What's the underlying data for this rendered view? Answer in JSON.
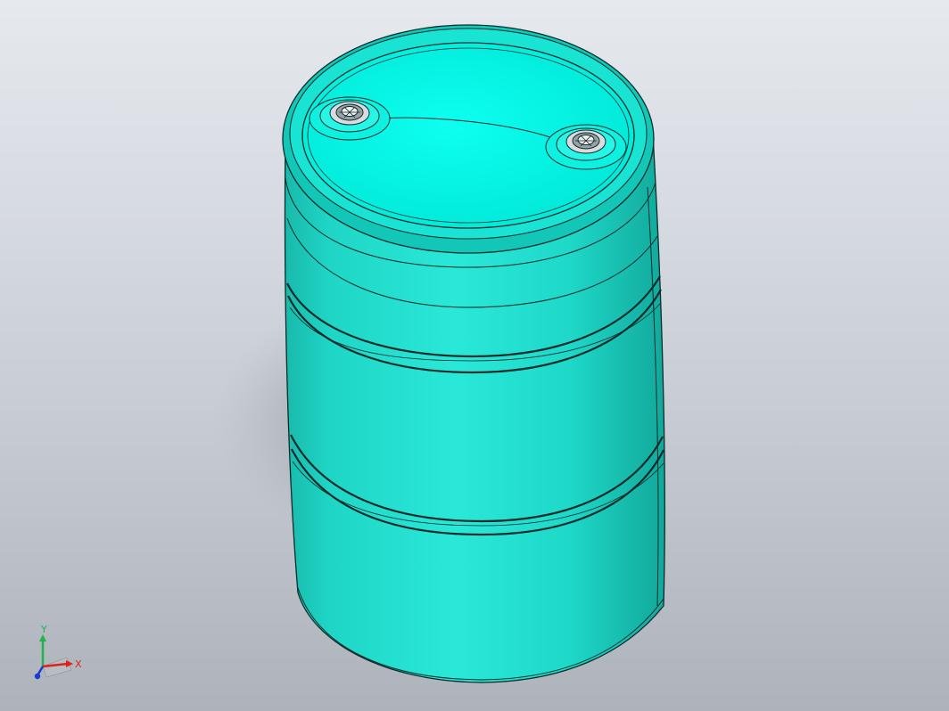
{
  "viewport": {
    "background_top": "#e6e9ee",
    "background_bottom": "#aeb3bb",
    "model": {
      "name": "drum",
      "body_color": "#1fd9c8",
      "lid_color": "#00ffee",
      "edge_color": "#0b2c2a"
    }
  },
  "triad": {
    "x_label": "X",
    "y_label": "Y",
    "x_color": "#e0201a",
    "y_color": "#22b34a",
    "z_color": "#1a3bd1"
  }
}
